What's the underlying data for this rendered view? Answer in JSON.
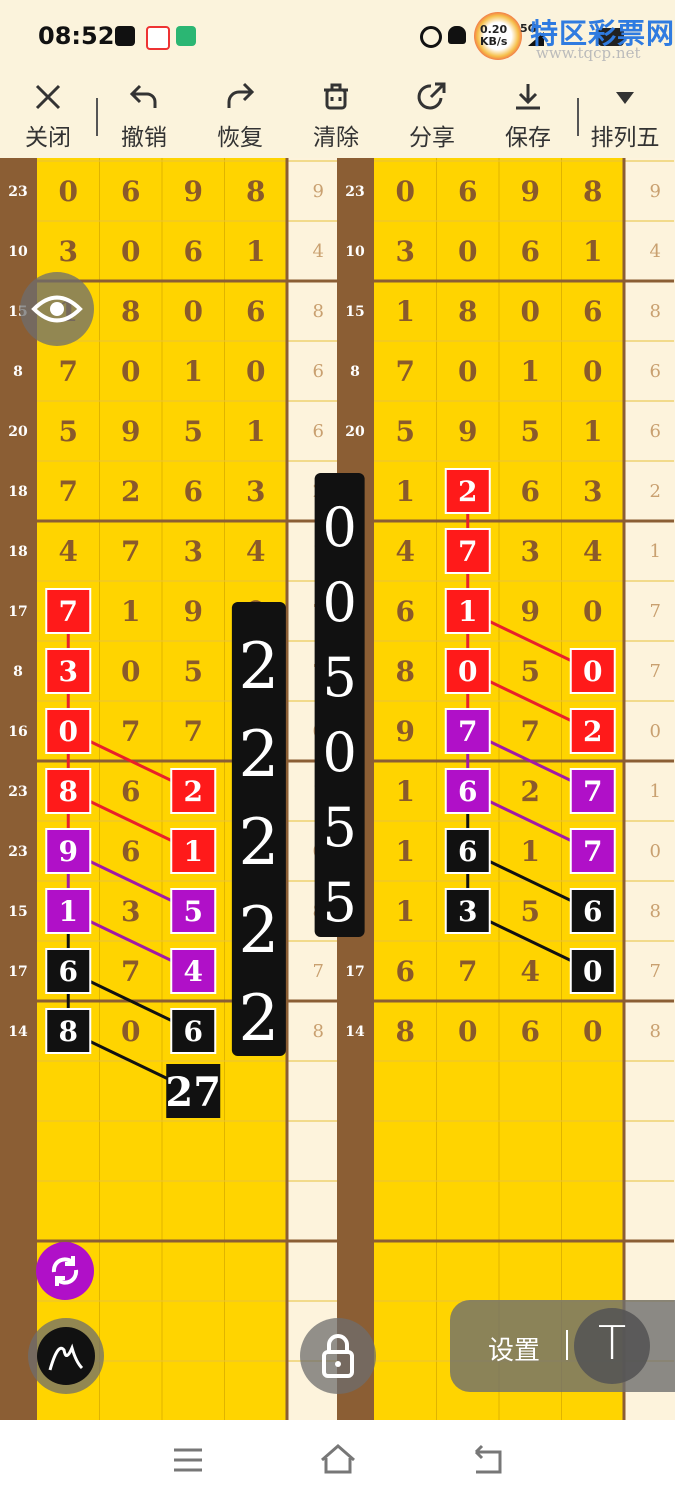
{
  "status": {
    "time": "08:52",
    "net_speed": "0.20 KB/s",
    "net_type": "5G",
    "watermark": "特区彩票网",
    "watermark_url": "www.tqcp.net"
  },
  "toolbar": {
    "items": [
      {
        "id": "close",
        "label": "关闭",
        "icon": "close-icon"
      },
      {
        "id": "undo",
        "label": "撤销",
        "icon": "undo-icon"
      },
      {
        "id": "redo",
        "label": "恢复",
        "icon": "redo-icon"
      },
      {
        "id": "clear",
        "label": "清除",
        "icon": "trash-icon"
      },
      {
        "id": "share",
        "label": "分享",
        "icon": "share-icon"
      },
      {
        "id": "save",
        "label": "保存",
        "icon": "download-icon"
      },
      {
        "id": "lottery",
        "label": "排列五",
        "icon": "triangle-down-icon"
      }
    ]
  },
  "board": {
    "panels": [
      {
        "labels": [
          "23",
          "10",
          "15",
          "8",
          "20",
          "18",
          "18",
          "17",
          "8",
          "16",
          "23",
          "23",
          "15",
          "17",
          "14"
        ],
        "rows": [
          [
            "0",
            "6",
            "9",
            "8",
            "9"
          ],
          [
            "3",
            "0",
            "6",
            "1",
            "4"
          ],
          [
            "1",
            "8",
            "0",
            "6",
            "8"
          ],
          [
            "7",
            "0",
            "1",
            "0",
            "6"
          ],
          [
            "5",
            "9",
            "5",
            "1",
            "6"
          ],
          [
            "7",
            "2",
            "6",
            "3",
            "2"
          ],
          [
            "4",
            "7",
            "3",
            "4",
            "1"
          ],
          [
            "7",
            "1",
            "9",
            "0",
            "7"
          ],
          [
            "3",
            "0",
            "5",
            "2",
            "7"
          ],
          [
            "0",
            "7",
            "7",
            "0",
            "0"
          ],
          [
            "8",
            "6",
            "2",
            "1",
            "1"
          ],
          [
            "9",
            "6",
            "1",
            "8",
            "0"
          ],
          [
            "1",
            "3",
            "5",
            "6",
            "8"
          ],
          [
            "6",
            "7",
            "4",
            "0",
            "7"
          ],
          [
            "8",
            "0",
            "6",
            "0",
            "8"
          ]
        ],
        "marks": [
          {
            "row": 7,
            "col": 0,
            "color": "red"
          },
          {
            "row": 8,
            "col": 0,
            "color": "red"
          },
          {
            "row": 9,
            "col": 0,
            "color": "red"
          },
          {
            "row": 10,
            "col": 0,
            "color": "red"
          },
          {
            "row": 11,
            "col": 0,
            "color": "purple"
          },
          {
            "row": 12,
            "col": 0,
            "color": "purple"
          },
          {
            "row": 13,
            "col": 0,
            "color": "black"
          },
          {
            "row": 14,
            "col": 0,
            "color": "black"
          },
          {
            "row": 10,
            "col": 2,
            "color": "red"
          },
          {
            "row": 11,
            "col": 2,
            "color": "red"
          },
          {
            "row": 12,
            "col": 2,
            "color": "purple"
          },
          {
            "row": 13,
            "col": 2,
            "color": "purple"
          },
          {
            "row": 14,
            "col": 2,
            "color": "black"
          }
        ],
        "lines": [
          [
            7,
            0,
            8,
            0,
            "red"
          ],
          [
            8,
            0,
            9,
            0,
            "red"
          ],
          [
            9,
            0,
            10,
            0,
            "red"
          ],
          [
            10,
            0,
            11,
            0,
            "red"
          ],
          [
            11,
            0,
            12,
            0,
            "purple"
          ],
          [
            12,
            0,
            13,
            0,
            "black"
          ],
          [
            13,
            0,
            14,
            0,
            "black"
          ],
          [
            9,
            0,
            10,
            2,
            "red"
          ],
          [
            10,
            0,
            11,
            2,
            "red"
          ],
          [
            11,
            0,
            12,
            2,
            "purple"
          ],
          [
            12,
            0,
            13,
            2,
            "purple"
          ],
          [
            13,
            0,
            14,
            2,
            "black"
          ],
          [
            14,
            0,
            15,
            2,
            "black"
          ]
        ],
        "result": {
          "row": 15,
          "col": 2,
          "text": "27"
        },
        "overlay": {
          "text": "22222",
          "col": 3.55,
          "row": 7.55
        }
      },
      {
        "labels": [
          "23",
          "10",
          "15",
          "8",
          "20",
          "18",
          "18",
          "17",
          "8",
          "16",
          "23",
          "23",
          "15",
          "17",
          "14"
        ],
        "rows": [
          [
            "0",
            "6",
            "9",
            "8",
            "9"
          ],
          [
            "3",
            "0",
            "6",
            "1",
            "4"
          ],
          [
            "1",
            "8",
            "0",
            "6",
            "8"
          ],
          [
            "7",
            "0",
            "1",
            "0",
            "6"
          ],
          [
            "5",
            "9",
            "5",
            "1",
            "6"
          ],
          [
            "1",
            "2",
            "6",
            "3",
            "2"
          ],
          [
            "4",
            "7",
            "3",
            "4",
            "1"
          ],
          [
            "6",
            "1",
            "9",
            "0",
            "7"
          ],
          [
            "8",
            "0",
            "5",
            "0",
            "7"
          ],
          [
            "9",
            "7",
            "7",
            "2",
            "0"
          ],
          [
            "1",
            "6",
            "2",
            "7",
            "1"
          ],
          [
            "1",
            "6",
            "1",
            "7",
            "0"
          ],
          [
            "1",
            "3",
            "5",
            "6",
            "8"
          ],
          [
            "6",
            "7",
            "4",
            "0",
            "7"
          ],
          [
            "8",
            "0",
            "6",
            "0",
            "8"
          ]
        ],
        "marks": [
          {
            "row": 5,
            "col": 1,
            "color": "red"
          },
          {
            "row": 6,
            "col": 1,
            "color": "red"
          },
          {
            "row": 7,
            "col": 1,
            "color": "red"
          },
          {
            "row": 8,
            "col": 1,
            "color": "red"
          },
          {
            "row": 9,
            "col": 1,
            "color": "purple"
          },
          {
            "row": 10,
            "col": 1,
            "color": "purple"
          },
          {
            "row": 11,
            "col": 1,
            "color": "black"
          },
          {
            "row": 12,
            "col": 1,
            "color": "black"
          },
          {
            "row": 8,
            "col": 3,
            "color": "red"
          },
          {
            "row": 9,
            "col": 3,
            "color": "red"
          },
          {
            "row": 10,
            "col": 3,
            "color": "purple"
          },
          {
            "row": 11,
            "col": 3,
            "color": "purple"
          },
          {
            "row": 12,
            "col": 3,
            "color": "black"
          },
          {
            "row": 13,
            "col": 3,
            "color": "black"
          }
        ],
        "lines": [
          [
            5,
            1,
            6,
            1,
            "red"
          ],
          [
            6,
            1,
            7,
            1,
            "red"
          ],
          [
            7,
            1,
            8,
            1,
            "red"
          ],
          [
            8,
            1,
            9,
            1,
            "red"
          ],
          [
            9,
            1,
            10,
            1,
            "purple"
          ],
          [
            10,
            1,
            11,
            1,
            "black"
          ],
          [
            11,
            1,
            12,
            1,
            "black"
          ],
          [
            7,
            1,
            8,
            3,
            "red"
          ],
          [
            8,
            1,
            9,
            3,
            "red"
          ],
          [
            9,
            1,
            10,
            3,
            "purple"
          ],
          [
            10,
            1,
            11,
            3,
            "purple"
          ],
          [
            11,
            1,
            12,
            3,
            "black"
          ],
          [
            12,
            1,
            13,
            3,
            "black"
          ]
        ],
        "result": null,
        "overlay": {
          "text": "005055",
          "col": -0.55,
          "row": 5.4
        }
      }
    ]
  },
  "controls": {
    "settings_label": "设置",
    "text_tool_label": "T"
  },
  "colors": {
    "board_yellow": "#ffd400",
    "label_brown": "#8b5e34",
    "mark_red": "#ff1a1a",
    "mark_purple": "#b010c8",
    "mark_black": "#111111",
    "digit": "#8a5a2b",
    "cream": "#fdf3dc"
  }
}
